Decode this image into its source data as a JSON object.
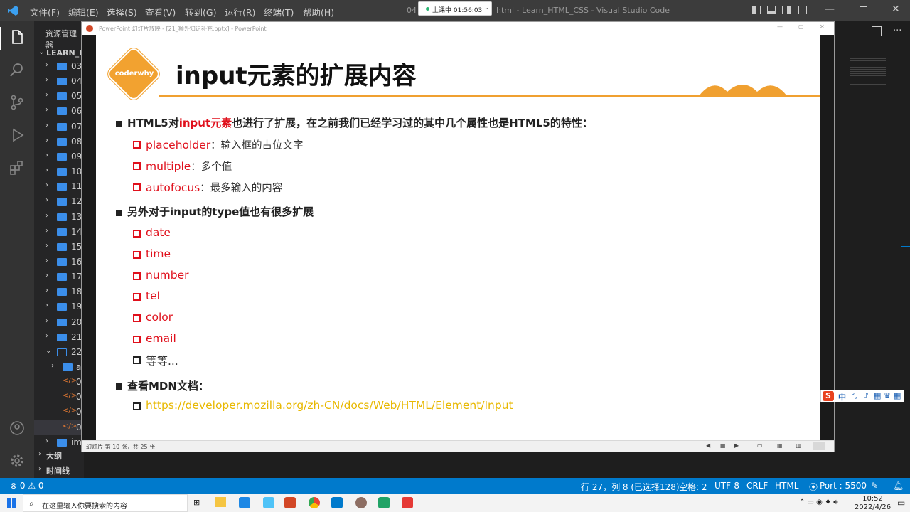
{
  "vscode": {
    "menu": [
      "文件(F)",
      "编辑(E)",
      "选择(S)",
      "查看(V)",
      "转到(G)",
      "运行(R)",
      "终端(T)",
      "帮助(H)"
    ],
    "window_title": "html - Learn_HTML_CSS - Visual Studio Code",
    "title_prefix": "04",
    "timer_label": "上课中 01:56:03",
    "explorer_label": "资源管理器",
    "workspace": "LEARN_HT",
    "folders": [
      "03",
      "04",
      "05",
      "06",
      "07",
      "08",
      "09",
      "10",
      "11",
      "12",
      "13",
      "14",
      "15",
      "16",
      "17",
      "18",
      "19",
      "20",
      "21",
      "22"
    ],
    "subfolder": "a",
    "files": [
      "0",
      "0",
      "0",
      "0"
    ],
    "last_folder": "im",
    "outline_label": "大纲",
    "timeline_label": "时间线",
    "status": {
      "problems": "⊗ 0  ⚠ 0",
      "position": "行 27，列 8 (已选择128)",
      "indent": "空格: 2",
      "encoding": "UTF-8",
      "eol": "CRLF",
      "language": "HTML",
      "port": "Port : 5500"
    }
  },
  "powerpoint": {
    "window_title": "PowerPoint 幻灯片放映 - [21_额外知识补充.pptx] - PowerPoint",
    "slide_counter": "幻灯片 第 10 张，共 25 张",
    "logo_text": "coderwhy",
    "slide_title": "input元素的扩展内容",
    "bullet1": {
      "prefix": "HTML5对",
      "highlight": "input元素",
      "suffix": "也进行了扩展，在之前我们已经学习过的其中几个属性也是HTML5的特性："
    },
    "attrs": [
      {
        "name": "placeholder",
        "desc": "：输入框的占位文字"
      },
      {
        "name": "multiple",
        "desc": "：多个值"
      },
      {
        "name": "autofocus",
        "desc": "：最多输入的内容"
      }
    ],
    "bullet2": "另外对于input的type值也有很多扩展",
    "types": [
      "date",
      "time",
      "number",
      "tel",
      "color",
      "email"
    ],
    "etc": "等等...",
    "bullet3": "查看MDN文档：",
    "mdn_link": "https://developer.mozilla.org/zh-CN/docs/Web/HTML/Element/Input"
  },
  "taskbar": {
    "search_placeholder": "在这里输入你要搜索的内容",
    "time": "10:52",
    "date": "2022/4/26",
    "ime": "中"
  },
  "colors": {
    "accent_orange": "#f0a030",
    "highlight_red": "#e0101c",
    "link_yellow": "#e8b800",
    "vscode_blue": "#007acc"
  }
}
